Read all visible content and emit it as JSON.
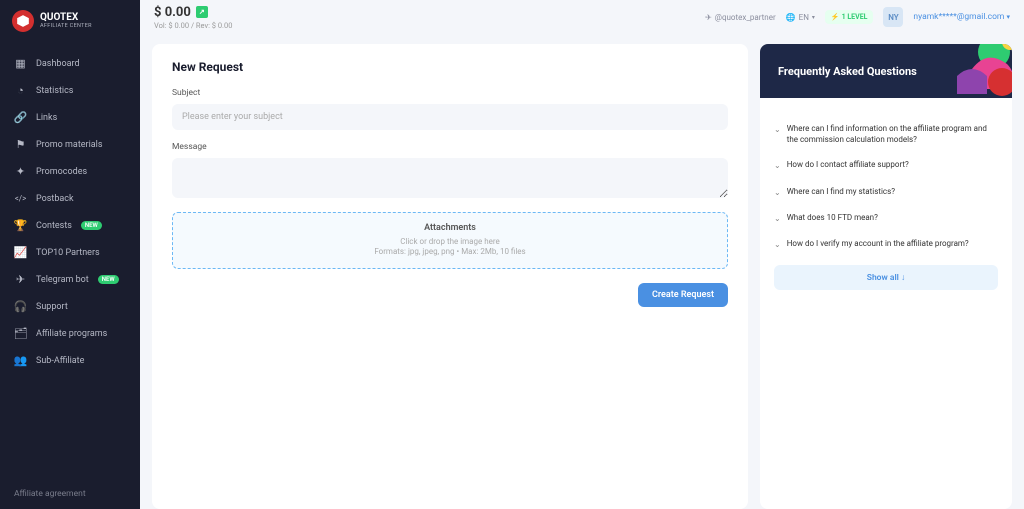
{
  "brand": {
    "name": "QUOTEX",
    "sub": "AFFILIATE CENTER"
  },
  "sidebar": {
    "items": [
      {
        "label": "Dashboard",
        "icon": "▦"
      },
      {
        "label": "Statistics",
        "icon": "◔"
      },
      {
        "label": "Links",
        "icon": "🔗"
      },
      {
        "label": "Promo materials",
        "icon": "⚑"
      },
      {
        "label": "Promocodes",
        "icon": "✦"
      },
      {
        "label": "Postback",
        "icon": "</>"
      },
      {
        "label": "Contests",
        "icon": "🏆",
        "badge": "NEW"
      },
      {
        "label": "TOP10 Partners",
        "icon": "📈"
      },
      {
        "label": "Telegram bot",
        "icon": "✈",
        "badge": "NEW"
      },
      {
        "label": "Support",
        "icon": "🎧"
      },
      {
        "label": "Affiliate programs",
        "icon": "🗂"
      },
      {
        "label": "Sub-Affiliate",
        "icon": "👥"
      }
    ],
    "footer": "Affiliate agreement"
  },
  "topbar": {
    "balance": "$ 0.00",
    "balance_sub": "Vol: $ 0.00 / Rev: $ 0.00",
    "telegram": "@quotex_partner",
    "lang": "EN",
    "level": "1 LEVEL",
    "avatar_initials": "NY",
    "email": "nyamk*****@gmail.com"
  },
  "request": {
    "title": "New Request",
    "subject_label": "Subject",
    "subject_placeholder": "Please enter your subject",
    "message_label": "Message",
    "attachments_title": "Attachments",
    "attachments_hint1": "Click or drop the image here",
    "attachments_hint2": "Formats: jpg, jpeg, png • Max: 2Mb, 10 files",
    "create_btn": "Create Request"
  },
  "faq": {
    "title": "Frequently Asked Questions",
    "items": [
      "Where can I find information on the affiliate program and the commission calculation models?",
      "How do I contact affiliate support?",
      "Where can I find my statistics?",
      "What does 10 FTD mean?",
      "How do I verify my account in the affiliate program?"
    ],
    "show_all": "Show all ↓"
  }
}
